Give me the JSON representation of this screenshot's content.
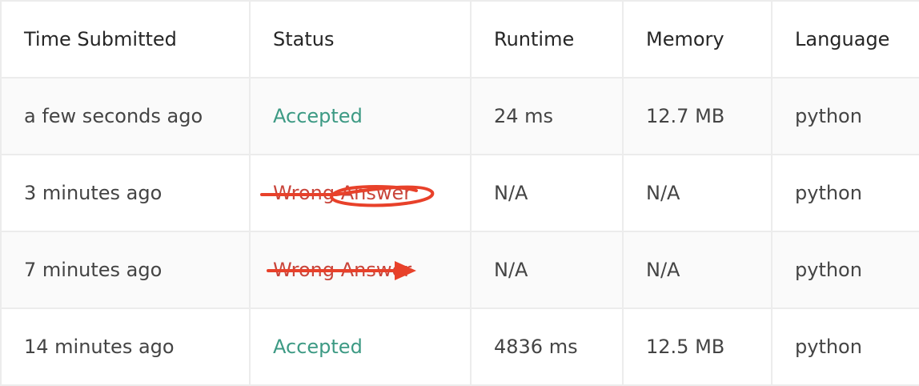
{
  "table": {
    "columns": [
      "Time Submitted",
      "Status",
      "Runtime",
      "Memory",
      "Language"
    ],
    "rows": [
      {
        "time": "a few seconds ago",
        "status": "Accepted",
        "status_type": "accepted",
        "runtime": "24 ms",
        "memory": "12.7 MB",
        "language": "python"
      },
      {
        "time": "3 minutes ago",
        "status": "Wrong Answer",
        "status_type": "wrong",
        "runtime": "N/A",
        "memory": "N/A",
        "language": "python"
      },
      {
        "time": "7 minutes ago",
        "status": "Wrong Answer",
        "status_type": "wrong",
        "runtime": "N/A",
        "memory": "N/A",
        "language": "python"
      },
      {
        "time": "14 minutes ago",
        "status": "Accepted",
        "status_type": "accepted",
        "runtime": "4836 ms",
        "memory": "12.5 MB",
        "language": "python"
      }
    ]
  },
  "colors": {
    "accepted": "#3d9a84",
    "wrong": "#c9453b",
    "annotation": "#e8412a"
  },
  "annotations": [
    "scribble-strikethrough-row-2",
    "arrow-strikethrough-row-3"
  ]
}
